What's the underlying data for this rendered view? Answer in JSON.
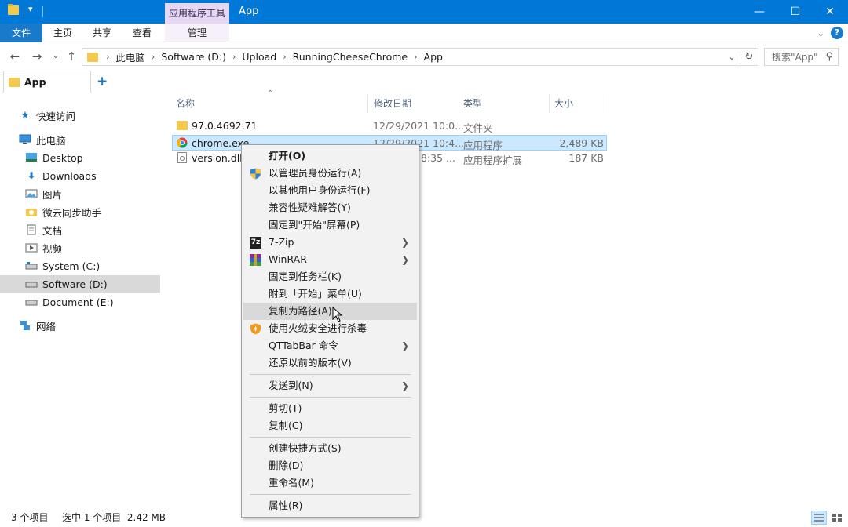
{
  "window": {
    "title": "App",
    "tools_tab": "应用程序工具",
    "controls": [
      "minimize-icon",
      "maximize-icon",
      "close-icon"
    ]
  },
  "ribbon": {
    "tabs": [
      "文件",
      "主页",
      "共享",
      "查看",
      "管理"
    ]
  },
  "address": {
    "crumbs": [
      "此电脑",
      "Software (D:)",
      "Upload",
      "RunningCheeseChrome",
      "App"
    ],
    "search_placeholder": "搜索\"App\""
  },
  "qttabs": {
    "active_tab": "App",
    "new_tab": "+"
  },
  "nav": {
    "quick_access": "快速访问",
    "this_pc": "此电脑",
    "items": [
      "Desktop",
      "Downloads",
      "图片",
      "微云同步助手",
      "文档",
      "视频",
      "System (C:)",
      "Software (D:)",
      "Document (E:)"
    ],
    "network": "网络"
  },
  "columns": {
    "name": "名称",
    "date": "修改日期",
    "type": "类型",
    "size": "大小"
  },
  "files": [
    {
      "name": "97.0.4692.71",
      "date": "12/29/2021 10:0...",
      "type": "文件夹",
      "size": ""
    },
    {
      "name": "chrome.exe",
      "date": "12/29/2021 10:4...",
      "type": "应用程序",
      "size": "2,489 KB"
    },
    {
      "name": "version.dll",
      "date": "8:35 ...",
      "type": "应用程序扩展",
      "size": "187 KB"
    }
  ],
  "context_menu": {
    "open": "打开(O)",
    "run_as_admin": "以管理员身份运行(A)",
    "run_as_other": "以其他用户身份运行(F)",
    "compat": "兼容性疑难解答(Y)",
    "pin_start_screen": "固定到\"开始\"屏幕(P)",
    "sevenzip": "7-Zip",
    "winrar": "WinRAR",
    "pin_taskbar": "固定到任务栏(K)",
    "pin_start_menu": "附到「开始」菜单(U)",
    "copy_path": "复制为路径(A)",
    "huorong": "使用火绒安全进行杀毒",
    "qttabbar": "QTTabBar 命令",
    "restore": "还原以前的版本(V)",
    "send_to": "发送到(N)",
    "cut": "剪切(T)",
    "copy": "复制(C)",
    "create_shortcut": "创建快捷方式(S)",
    "delete": "删除(D)",
    "rename": "重命名(M)",
    "properties": "属性(R)"
  },
  "status": {
    "count": "3 个项目",
    "selection": "选中 1 个项目  2.42 MB"
  }
}
